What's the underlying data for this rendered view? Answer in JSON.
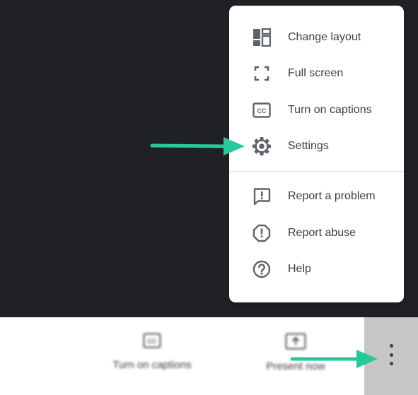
{
  "menu": {
    "items": [
      {
        "label": "Change layout",
        "icon": "dashboard-icon"
      },
      {
        "label": "Full screen",
        "icon": "fullscreen-icon"
      },
      {
        "label": "Turn on captions",
        "icon": "closed-captions-icon"
      },
      {
        "label": "Settings",
        "icon": "gear-icon"
      },
      {
        "label": "Report a problem",
        "icon": "feedback-icon"
      },
      {
        "label": "Report abuse",
        "icon": "report-octagon-icon"
      },
      {
        "label": "Help",
        "icon": "help-circle-icon"
      }
    ]
  },
  "bottom_bar": {
    "captions_label": "Turn on captions",
    "present_label": "Present now",
    "more_icon": "more-vertical-icon"
  },
  "colors": {
    "stage_bg": "#202124",
    "menu_bg": "#ffffff",
    "menu_text": "#3c4043",
    "icon_color": "#5f6368",
    "arrow_color": "#26c99a",
    "more_area_bg": "#c6c6c6"
  }
}
